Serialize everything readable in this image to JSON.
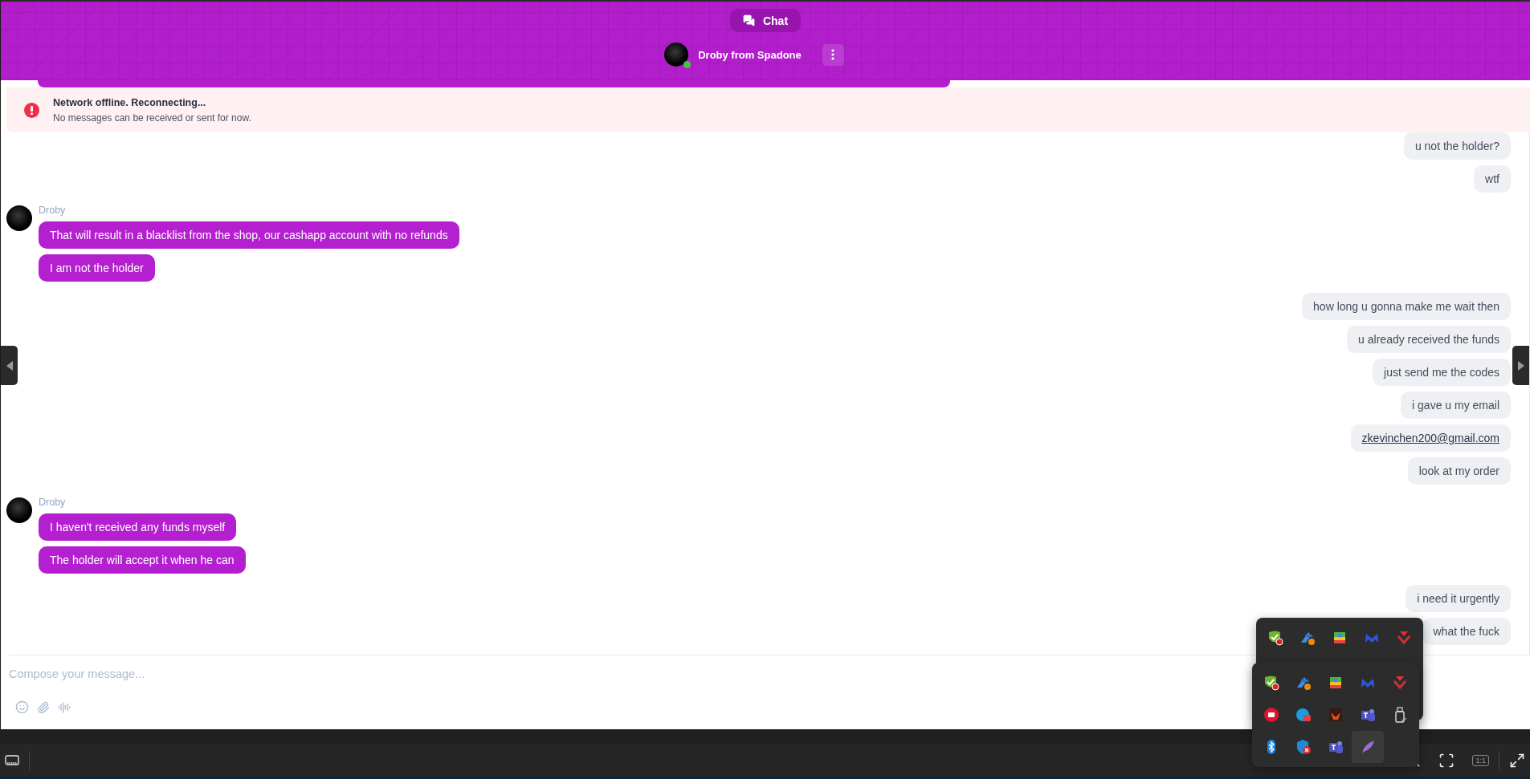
{
  "header": {
    "tab": {
      "label": "Chat",
      "selected": true
    },
    "contact": {
      "name": "Droby from Spadone",
      "online": true
    }
  },
  "alert": {
    "title": "Network offline. Reconnecting...",
    "message": "No messages can be received or sent for now."
  },
  "messages": [
    {
      "kind": "outgoing",
      "bubbles": [
        {
          "kind": "text",
          "text": "u not the holder?"
        },
        {
          "kind": "text",
          "text": "wtf"
        }
      ]
    },
    {
      "kind": "incoming",
      "sender": "Droby",
      "bubbles": [
        {
          "kind": "text",
          "text": "That will result in a blacklist from the shop, our cashapp account with no refunds"
        },
        {
          "kind": "text",
          "text": "I am not the holder"
        }
      ]
    },
    {
      "kind": "outgoing",
      "bubbles": [
        {
          "kind": "text",
          "text": "how long u gonna make me wait then"
        },
        {
          "kind": "text",
          "text": "u already received the funds"
        },
        {
          "kind": "text",
          "text": "just send me the codes"
        },
        {
          "kind": "text",
          "text": "i gave u my email"
        },
        {
          "kind": "link",
          "text": "zkevinchen200@gmail.com"
        },
        {
          "kind": "text",
          "text": "look at my order"
        }
      ]
    },
    {
      "kind": "incoming",
      "sender": "Droby",
      "bubbles": [
        {
          "kind": "text",
          "text": "I haven't received any funds myself"
        },
        {
          "kind": "text",
          "text": "The holder will accept it when he can"
        }
      ]
    },
    {
      "kind": "outgoing",
      "bubbles": [
        {
          "kind": "text",
          "text": "i need it urgently"
        },
        {
          "kind": "text",
          "text": "what the fuck"
        }
      ]
    }
  ],
  "composer": {
    "placeholder": "Compose your message..."
  },
  "viewer_toolbar": {
    "zoom_label": "1:1"
  },
  "tray": {
    "back_row": [
      {
        "kind": "check-badge"
      },
      {
        "kind": "arrow-dot"
      },
      {
        "kind": "layers"
      },
      {
        "kind": "m-logo"
      },
      {
        "kind": "chevron"
      }
    ],
    "front_grid": [
      {
        "kind": "check-badge",
        "hovered": false
      },
      {
        "kind": "arrow-dot",
        "hovered": false
      },
      {
        "kind": "layers",
        "hovered": false
      },
      {
        "kind": "m-logo",
        "hovered": false
      },
      {
        "kind": "chevron",
        "hovered": false
      },
      {
        "kind": "red-circle",
        "hovered": false
      },
      {
        "kind": "blue-badge",
        "hovered": false
      },
      {
        "kind": "dark-square",
        "hovered": false
      },
      {
        "kind": "teams",
        "hovered": false
      },
      {
        "kind": "usb",
        "hovered": false
      },
      {
        "kind": "bluetooth",
        "hovered": false
      },
      {
        "kind": "shield-x",
        "hovered": false
      },
      {
        "kind": "teams",
        "hovered": false
      },
      {
        "kind": "feather",
        "hovered": true
      }
    ]
  }
}
